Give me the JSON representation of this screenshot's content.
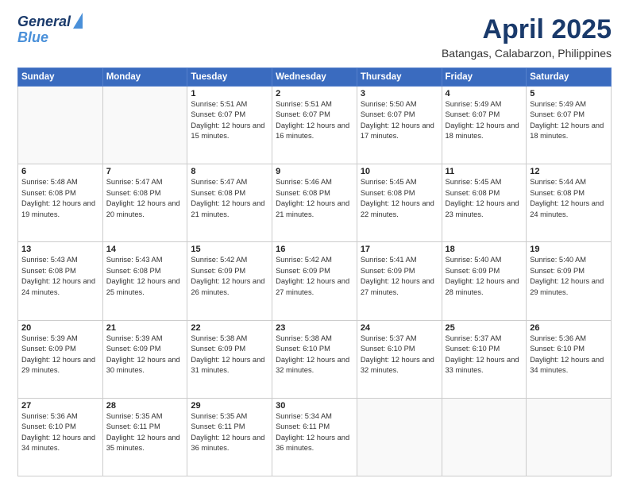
{
  "header": {
    "logo_line1": "General",
    "logo_line2": "Blue",
    "month": "April 2025",
    "location": "Batangas, Calabarzon, Philippines"
  },
  "weekdays": [
    "Sunday",
    "Monday",
    "Tuesday",
    "Wednesday",
    "Thursday",
    "Friday",
    "Saturday"
  ],
  "weeks": [
    [
      {
        "day": "",
        "sunrise": "",
        "sunset": "",
        "daylight": ""
      },
      {
        "day": "",
        "sunrise": "",
        "sunset": "",
        "daylight": ""
      },
      {
        "day": "1",
        "sunrise": "Sunrise: 5:51 AM",
        "sunset": "Sunset: 6:07 PM",
        "daylight": "Daylight: 12 hours and 15 minutes."
      },
      {
        "day": "2",
        "sunrise": "Sunrise: 5:51 AM",
        "sunset": "Sunset: 6:07 PM",
        "daylight": "Daylight: 12 hours and 16 minutes."
      },
      {
        "day": "3",
        "sunrise": "Sunrise: 5:50 AM",
        "sunset": "Sunset: 6:07 PM",
        "daylight": "Daylight: 12 hours and 17 minutes."
      },
      {
        "day": "4",
        "sunrise": "Sunrise: 5:49 AM",
        "sunset": "Sunset: 6:07 PM",
        "daylight": "Daylight: 12 hours and 18 minutes."
      },
      {
        "day": "5",
        "sunrise": "Sunrise: 5:49 AM",
        "sunset": "Sunset: 6:07 PM",
        "daylight": "Daylight: 12 hours and 18 minutes."
      }
    ],
    [
      {
        "day": "6",
        "sunrise": "Sunrise: 5:48 AM",
        "sunset": "Sunset: 6:08 PM",
        "daylight": "Daylight: 12 hours and 19 minutes."
      },
      {
        "day": "7",
        "sunrise": "Sunrise: 5:47 AM",
        "sunset": "Sunset: 6:08 PM",
        "daylight": "Daylight: 12 hours and 20 minutes."
      },
      {
        "day": "8",
        "sunrise": "Sunrise: 5:47 AM",
        "sunset": "Sunset: 6:08 PM",
        "daylight": "Daylight: 12 hours and 21 minutes."
      },
      {
        "day": "9",
        "sunrise": "Sunrise: 5:46 AM",
        "sunset": "Sunset: 6:08 PM",
        "daylight": "Daylight: 12 hours and 21 minutes."
      },
      {
        "day": "10",
        "sunrise": "Sunrise: 5:45 AM",
        "sunset": "Sunset: 6:08 PM",
        "daylight": "Daylight: 12 hours and 22 minutes."
      },
      {
        "day": "11",
        "sunrise": "Sunrise: 5:45 AM",
        "sunset": "Sunset: 6:08 PM",
        "daylight": "Daylight: 12 hours and 23 minutes."
      },
      {
        "day": "12",
        "sunrise": "Sunrise: 5:44 AM",
        "sunset": "Sunset: 6:08 PM",
        "daylight": "Daylight: 12 hours and 24 minutes."
      }
    ],
    [
      {
        "day": "13",
        "sunrise": "Sunrise: 5:43 AM",
        "sunset": "Sunset: 6:08 PM",
        "daylight": "Daylight: 12 hours and 24 minutes."
      },
      {
        "day": "14",
        "sunrise": "Sunrise: 5:43 AM",
        "sunset": "Sunset: 6:08 PM",
        "daylight": "Daylight: 12 hours and 25 minutes."
      },
      {
        "day": "15",
        "sunrise": "Sunrise: 5:42 AM",
        "sunset": "Sunset: 6:09 PM",
        "daylight": "Daylight: 12 hours and 26 minutes."
      },
      {
        "day": "16",
        "sunrise": "Sunrise: 5:42 AM",
        "sunset": "Sunset: 6:09 PM",
        "daylight": "Daylight: 12 hours and 27 minutes."
      },
      {
        "day": "17",
        "sunrise": "Sunrise: 5:41 AM",
        "sunset": "Sunset: 6:09 PM",
        "daylight": "Daylight: 12 hours and 27 minutes."
      },
      {
        "day": "18",
        "sunrise": "Sunrise: 5:40 AM",
        "sunset": "Sunset: 6:09 PM",
        "daylight": "Daylight: 12 hours and 28 minutes."
      },
      {
        "day": "19",
        "sunrise": "Sunrise: 5:40 AM",
        "sunset": "Sunset: 6:09 PM",
        "daylight": "Daylight: 12 hours and 29 minutes."
      }
    ],
    [
      {
        "day": "20",
        "sunrise": "Sunrise: 5:39 AM",
        "sunset": "Sunset: 6:09 PM",
        "daylight": "Daylight: 12 hours and 29 minutes."
      },
      {
        "day": "21",
        "sunrise": "Sunrise: 5:39 AM",
        "sunset": "Sunset: 6:09 PM",
        "daylight": "Daylight: 12 hours and 30 minutes."
      },
      {
        "day": "22",
        "sunrise": "Sunrise: 5:38 AM",
        "sunset": "Sunset: 6:09 PM",
        "daylight": "Daylight: 12 hours and 31 minutes."
      },
      {
        "day": "23",
        "sunrise": "Sunrise: 5:38 AM",
        "sunset": "Sunset: 6:10 PM",
        "daylight": "Daylight: 12 hours and 32 minutes."
      },
      {
        "day": "24",
        "sunrise": "Sunrise: 5:37 AM",
        "sunset": "Sunset: 6:10 PM",
        "daylight": "Daylight: 12 hours and 32 minutes."
      },
      {
        "day": "25",
        "sunrise": "Sunrise: 5:37 AM",
        "sunset": "Sunset: 6:10 PM",
        "daylight": "Daylight: 12 hours and 33 minutes."
      },
      {
        "day": "26",
        "sunrise": "Sunrise: 5:36 AM",
        "sunset": "Sunset: 6:10 PM",
        "daylight": "Daylight: 12 hours and 34 minutes."
      }
    ],
    [
      {
        "day": "27",
        "sunrise": "Sunrise: 5:36 AM",
        "sunset": "Sunset: 6:10 PM",
        "daylight": "Daylight: 12 hours and 34 minutes."
      },
      {
        "day": "28",
        "sunrise": "Sunrise: 5:35 AM",
        "sunset": "Sunset: 6:11 PM",
        "daylight": "Daylight: 12 hours and 35 minutes."
      },
      {
        "day": "29",
        "sunrise": "Sunrise: 5:35 AM",
        "sunset": "Sunset: 6:11 PM",
        "daylight": "Daylight: 12 hours and 36 minutes."
      },
      {
        "day": "30",
        "sunrise": "Sunrise: 5:34 AM",
        "sunset": "Sunset: 6:11 PM",
        "daylight": "Daylight: 12 hours and 36 minutes."
      },
      {
        "day": "",
        "sunrise": "",
        "sunset": "",
        "daylight": ""
      },
      {
        "day": "",
        "sunrise": "",
        "sunset": "",
        "daylight": ""
      },
      {
        "day": "",
        "sunrise": "",
        "sunset": "",
        "daylight": ""
      }
    ]
  ]
}
